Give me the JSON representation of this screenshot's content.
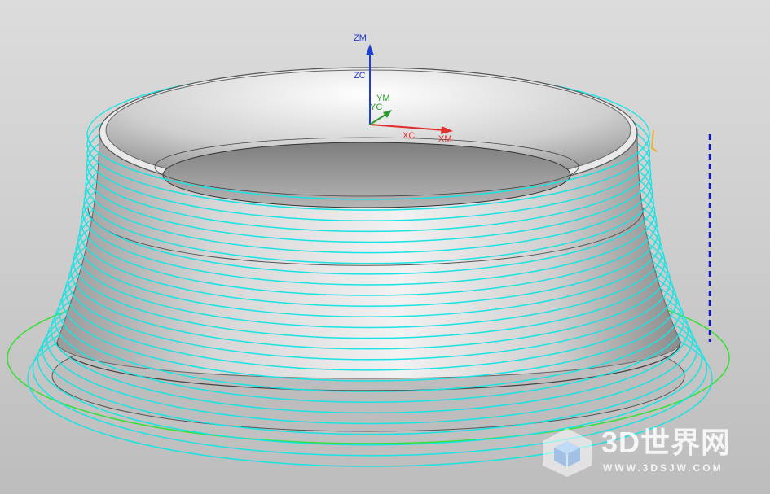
{
  "viewport": {
    "background_top": "#dcdcdc",
    "background_bottom": "#bdbdbd"
  },
  "axes": {
    "zm": "ZM",
    "zc": "ZC",
    "ym": "YM",
    "yc": "YC",
    "xc": "XC",
    "xm": "XM",
    "z_color": "#1c3fd0",
    "y_color": "#2e9b2e",
    "x_color": "#e03030"
  },
  "model": {
    "part_color": "#c9c9c9",
    "toolpath_color": "#19e3e3",
    "boundary_color": "#33e033",
    "tool_axis_color": "#1414c8",
    "tool_marker_color": "#f0b030"
  },
  "watermark": {
    "brand": "3D世界网",
    "url": "WWW.3DSJW.COM"
  }
}
